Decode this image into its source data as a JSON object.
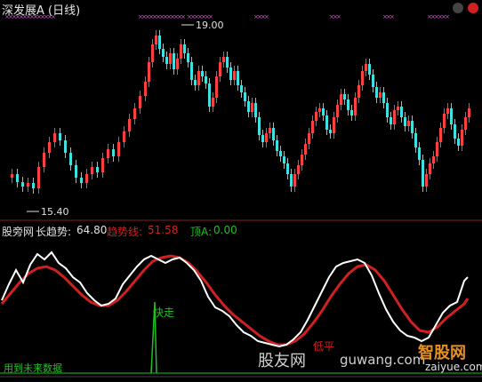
{
  "window": {
    "title": "深发展A (日线)"
  },
  "price_panel": {
    "high_label": "19.00",
    "low_label": "15.40"
  },
  "indicator_panel": {
    "prefix": "股旁网",
    "long_label": "长趋势:",
    "long_value": "64.80",
    "trend_label": "趋势线:",
    "trend_value": "51.58",
    "top_label": "顶A:",
    "top_value": "0.00",
    "fast_label": "快走",
    "low_label": "低平",
    "footer_text": "用到未来数据"
  },
  "watermarks": {
    "left": "股友网",
    "right": "guwang.com",
    "badge": "智股网",
    "badge_url": "zaiyue.com"
  },
  "colors": {
    "background": "#000000",
    "up_candle": "#ff4040",
    "down_candle": "#40e0e0",
    "long_trend_line": "#ffffff",
    "trend_line": "#d02020",
    "signal_line": "#20c020",
    "marker": "#e050e0",
    "top_value_color": "#20c020"
  },
  "chart_data": {
    "type": "candlestick+line",
    "price_high": 19.0,
    "price_low": 15.4,
    "series": [
      {
        "name": "长趋势",
        "last_value": 64.8
      },
      {
        "name": "趋势线",
        "last_value": 51.58
      },
      {
        "name": "顶A",
        "last_value": 0.0
      }
    ]
  }
}
